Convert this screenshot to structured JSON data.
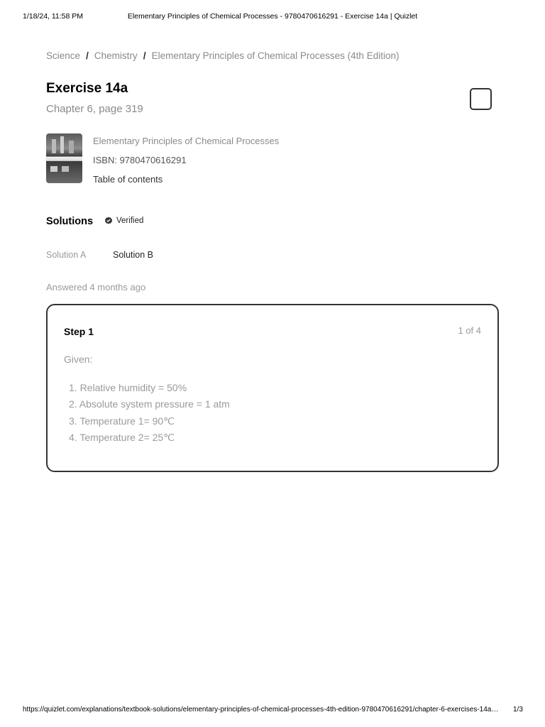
{
  "print_header": {
    "date": "1/18/24, 11:58 PM",
    "title": "Elementary Principles of Chemical Processes - 9780470616291 - Exercise 14a | Quizlet"
  },
  "breadcrumb": {
    "items": [
      "Science",
      "Chemistry",
      "Elementary Principles of Chemical Processes (4th Edition)"
    ],
    "separator": "/"
  },
  "exercise": {
    "title": "Exercise 14a",
    "subtitle": "Chapter 6, page 319"
  },
  "bookmark": {
    "icon": "bookmark-icon"
  },
  "book": {
    "name": "Elementary Principles of Chemical Processes",
    "isbn": "ISBN: 9780470616291",
    "toc": "Table of contents"
  },
  "solutions": {
    "heading": "Solutions",
    "verified": "Verified",
    "verified_icon": "verified-badge-icon"
  },
  "tabs": [
    "Solution A",
    "Solution B"
  ],
  "answered": "Answered 4 months ago",
  "step": {
    "title": "Step 1",
    "count": "1 of 4",
    "given_label": "Given:",
    "items": [
      "1. Relative humidity = 50%",
      "2. Absolute system pressure = 1 atm",
      "3. Temperature 1= 90℃",
      "4. Temperature 2= 25℃"
    ]
  },
  "print_footer": {
    "url": "https://quizlet.com/explanations/textbook-solutions/elementary-principles-of-chemical-processes-4th-edition-9780470616291/chapter-6-exercises-14a…",
    "page": "1/3"
  }
}
